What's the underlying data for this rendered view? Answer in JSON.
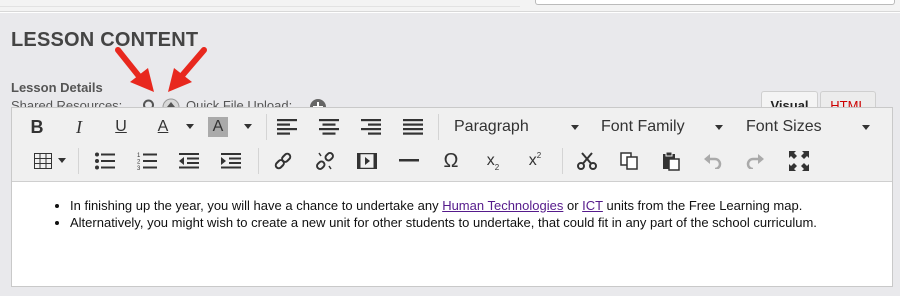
{
  "section": {
    "title": "LESSON CONTENT"
  },
  "details": {
    "label": "Lesson Details",
    "shared_resources": "Shared Resources:",
    "quick_upload": "Quick File Upload:"
  },
  "tabs": {
    "visual": "Visual",
    "html": "HTML"
  },
  "toolbar": {
    "bold": "B",
    "italic": "I",
    "underline": "U",
    "text_color": "A",
    "bg_color": "A",
    "format": "Paragraph",
    "font_family": "Font Family",
    "font_size": "Font Sizes",
    "special_char": "Ω",
    "subscript_base": "x",
    "subscript_mark": "2",
    "superscript_base": "x",
    "superscript_mark": "2"
  },
  "content": {
    "bullet1_part1": "In finishing up the year, you will have a chance to undertake any ",
    "bullet1_link1": "Human Technologies",
    "bullet1_part2": " or ",
    "bullet1_link2": "ICT",
    "bullet1_part3": " units from the Free Learning map.",
    "bullet2": "Alternatively, you might wish to create a new unit for other students to undertake, that could fit in any part of the school curriculum."
  },
  "colors": {
    "arrow": "#e8281e",
    "html_tab": "#cc0000",
    "link": "#551a8b"
  }
}
